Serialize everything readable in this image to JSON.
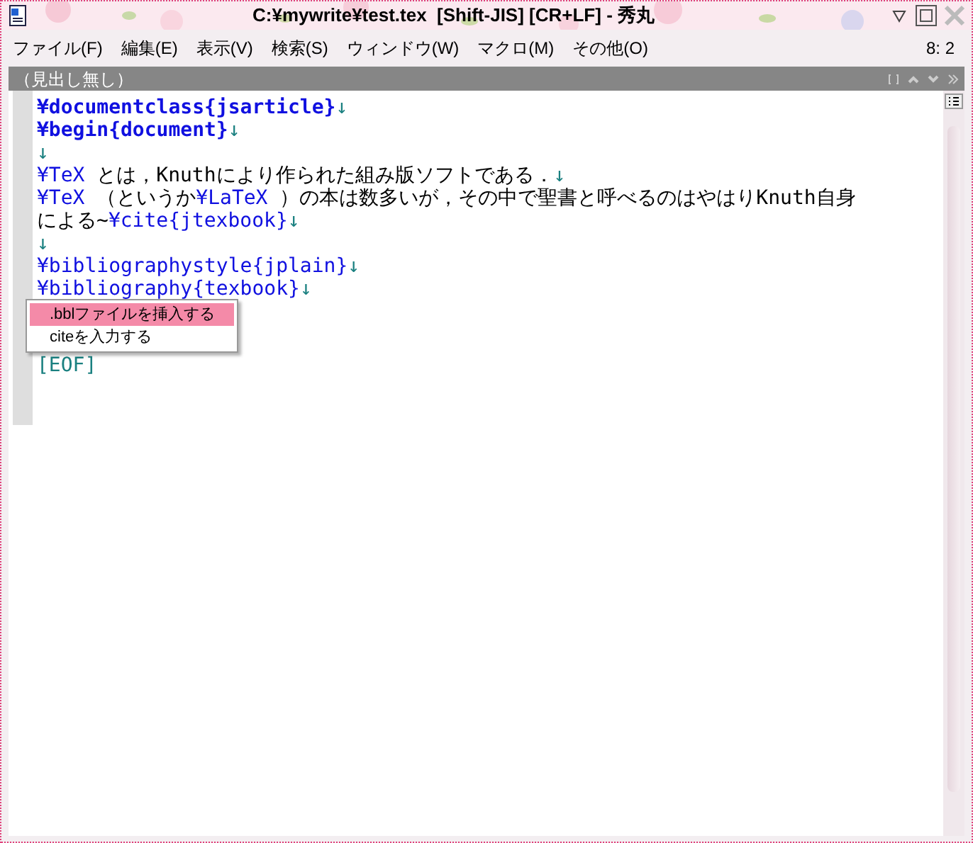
{
  "window": {
    "title": "C:¥mywrite¥test.tex  [Shift-JIS] [CR+LF] - 秀丸"
  },
  "menu": [
    {
      "label": "ファイル(F)"
    },
    {
      "label": "編集(E)"
    },
    {
      "label": "表示(V)"
    },
    {
      "label": "検索(S)"
    },
    {
      "label": "ウィンドウ(W)"
    },
    {
      "label": "マクロ(M)"
    },
    {
      "label": "その他(O)"
    }
  ],
  "cursor_position": "8: 2",
  "heading_bar": {
    "label": "（見出し無し）"
  },
  "editor": {
    "lines": [
      [
        {
          "kind": "keyword",
          "text": "¥documentclass{jsarticle}"
        },
        {
          "kind": "newline",
          "text": "↓"
        }
      ],
      [
        {
          "kind": "keyword",
          "text": "¥begin{document}"
        },
        {
          "kind": "newline",
          "text": "↓"
        }
      ],
      [
        {
          "kind": "newline",
          "text": "↓"
        }
      ],
      [
        {
          "kind": "command",
          "text": "¥TeX"
        },
        {
          "kind": "text",
          "text": " とは，Knuthにより作られた組み版ソフトである．"
        },
        {
          "kind": "newline",
          "text": "↓"
        }
      ],
      [
        {
          "kind": "command",
          "text": "¥TeX"
        },
        {
          "kind": "text",
          "text": " （というか"
        },
        {
          "kind": "command",
          "text": "¥LaTeX"
        },
        {
          "kind": "text",
          "text": " ）の本は数多いが，その中で聖書と呼べるのはやはりKnuth自身"
        }
      ],
      [
        {
          "kind": "text",
          "text": "による~"
        },
        {
          "kind": "command",
          "text": "¥cite{jtexbook}"
        },
        {
          "kind": "newline",
          "text": "↓"
        }
      ],
      [
        {
          "kind": "newline",
          "text": "↓"
        }
      ],
      [
        {
          "kind": "command",
          "text": "¥bibliographystyle{jplain}"
        },
        {
          "kind": "newline",
          "text": "↓"
        }
      ],
      [
        {
          "kind": "command",
          "text": "¥bibliography{texbook}"
        },
        {
          "kind": "newline",
          "text": "↓"
        }
      ],
      [
        {
          "kind": "eof",
          "text": "[EOF]"
        }
      ]
    ]
  },
  "popup_menu": [
    {
      "label": ".bblファイルを挿入する",
      "selected": true
    },
    {
      "label": "citeを入力する",
      "selected": false
    }
  ]
}
